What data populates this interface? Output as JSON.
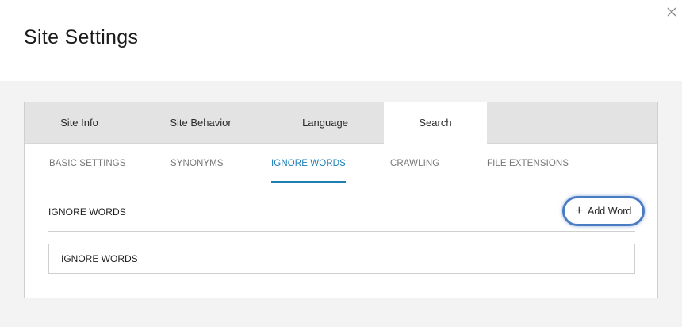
{
  "modal": {
    "title": "Site Settings"
  },
  "tabs": [
    {
      "label": "Site Info"
    },
    {
      "label": "Site Behavior"
    },
    {
      "label": "Language"
    },
    {
      "label": "Search"
    }
  ],
  "active_tab": "Search",
  "subtabs": [
    {
      "label": "BASIC SETTINGS"
    },
    {
      "label": "SYNONYMS"
    },
    {
      "label": "IGNORE WORDS"
    },
    {
      "label": "CRAWLING"
    },
    {
      "label": "FILE EXTENSIONS"
    }
  ],
  "active_subtab": "IGNORE WORDS",
  "section": {
    "label": "IGNORE WORDS",
    "add_button_label": "Add Word",
    "table_header": "IGNORE WORDS"
  },
  "icons": {
    "close": "close-icon",
    "add": "plus-icon"
  },
  "colors": {
    "accent": "#1f7fb4",
    "focus_ring": "#4a7cc3",
    "body_background": "#f3f3f3",
    "tabbar_background": "#e3e3e3"
  }
}
